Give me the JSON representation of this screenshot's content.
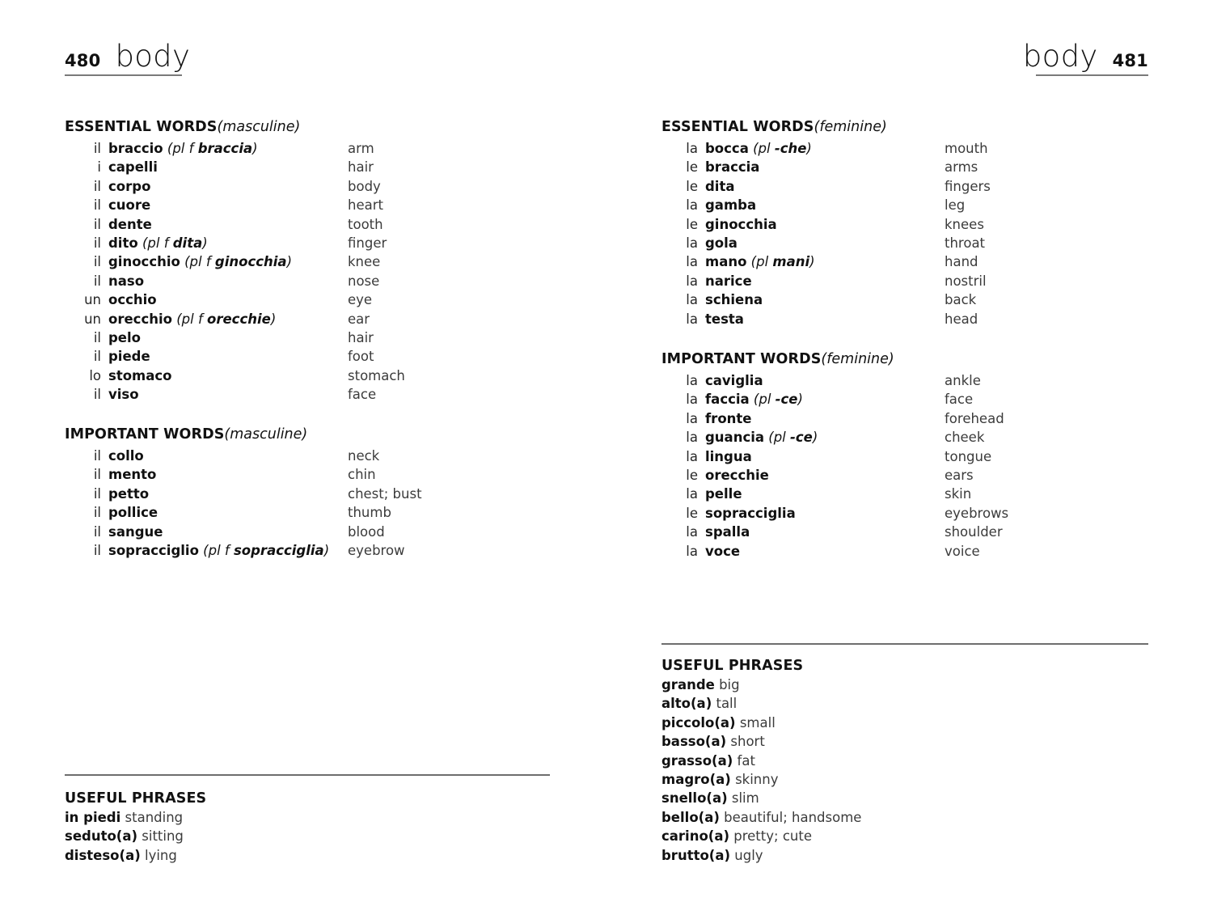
{
  "spread": {
    "left_page": {
      "folio": "480",
      "running_head": "body",
      "sections": [
        {
          "title": "ESSENTIAL WORDS",
          "gender": "(masculine)",
          "entries": [
            {
              "article": "il",
              "term": "braccio",
              "plural_open": " (",
              "plural_label": "pl f ",
              "plural_form": "braccia",
              "plural_close": ")",
              "gloss": "arm"
            },
            {
              "article": "i",
              "term": "capelli",
              "plural_open": "",
              "plural_label": "",
              "plural_form": "",
              "plural_close": "",
              "gloss": "hair"
            },
            {
              "article": "il",
              "term": "corpo",
              "plural_open": "",
              "plural_label": "",
              "plural_form": "",
              "plural_close": "",
              "gloss": "body"
            },
            {
              "article": "il",
              "term": "cuore",
              "plural_open": "",
              "plural_label": "",
              "plural_form": "",
              "plural_close": "",
              "gloss": "heart"
            },
            {
              "article": "il",
              "term": "dente",
              "plural_open": "",
              "plural_label": "",
              "plural_form": "",
              "plural_close": "",
              "gloss": "tooth"
            },
            {
              "article": "il",
              "term": "dito",
              "plural_open": " (",
              "plural_label": "pl f ",
              "plural_form": "dita",
              "plural_close": ")",
              "gloss": "finger"
            },
            {
              "article": "il",
              "term": "ginocchio",
              "plural_open": " (",
              "plural_label": "pl f ",
              "plural_form": "ginocchia",
              "plural_close": ")",
              "gloss": "knee"
            },
            {
              "article": "il",
              "term": "naso",
              "plural_open": "",
              "plural_label": "",
              "plural_form": "",
              "plural_close": "",
              "gloss": "nose"
            },
            {
              "article": "un",
              "term": "occhio",
              "plural_open": "",
              "plural_label": "",
              "plural_form": "",
              "plural_close": "",
              "gloss": "eye"
            },
            {
              "article": "un",
              "term": "orecchio",
              "plural_open": " (",
              "plural_label": "pl f ",
              "plural_form": "orecchie",
              "plural_close": ")",
              "gloss": "ear"
            },
            {
              "article": "il",
              "term": "pelo",
              "plural_open": "",
              "plural_label": "",
              "plural_form": "",
              "plural_close": "",
              "gloss": "hair"
            },
            {
              "article": "il",
              "term": "piede",
              "plural_open": "",
              "plural_label": "",
              "plural_form": "",
              "plural_close": "",
              "gloss": "foot"
            },
            {
              "article": "lo",
              "term": "stomaco",
              "plural_open": "",
              "plural_label": "",
              "plural_form": "",
              "plural_close": "",
              "gloss": "stomach"
            },
            {
              "article": "il",
              "term": "viso",
              "plural_open": "",
              "plural_label": "",
              "plural_form": "",
              "plural_close": "",
              "gloss": "face"
            }
          ]
        },
        {
          "title": "IMPORTANT WORDS",
          "gender": "(masculine)",
          "entries": [
            {
              "article": "il",
              "term": "collo",
              "plural_open": "",
              "plural_label": "",
              "plural_form": "",
              "plural_close": "",
              "gloss": "neck"
            },
            {
              "article": "il",
              "term": "mento",
              "plural_open": "",
              "plural_label": "",
              "plural_form": "",
              "plural_close": "",
              "gloss": "chin"
            },
            {
              "article": "il",
              "term": "petto",
              "plural_open": "",
              "plural_label": "",
              "plural_form": "",
              "plural_close": "",
              "gloss": "chest; bust"
            },
            {
              "article": "il",
              "term": "pollice",
              "plural_open": "",
              "plural_label": "",
              "plural_form": "",
              "plural_close": "",
              "gloss": "thumb"
            },
            {
              "article": "il",
              "term": "sangue",
              "plural_open": "",
              "plural_label": "",
              "plural_form": "",
              "plural_close": "",
              "gloss": "blood"
            },
            {
              "article": "il",
              "term": "sopracciglio",
              "plural_open": " (",
              "plural_label": "pl f ",
              "plural_form": "sopracciglia",
              "plural_close": ")",
              "gloss": "eyebrow"
            }
          ]
        }
      ],
      "useful_phrases": {
        "title": "USEFUL PHRASES",
        "items": [
          {
            "italian": "in piedi",
            "english": " standing"
          },
          {
            "italian": "seduto(a)",
            "english": " sitting"
          },
          {
            "italian": "disteso(a)",
            "english": " lying"
          }
        ]
      }
    },
    "right_page": {
      "folio": "481",
      "running_head": "body",
      "sections": [
        {
          "title": "ESSENTIAL WORDS",
          "gender": "(feminine)",
          "entries": [
            {
              "article": "la",
              "term": "bocca",
              "plural_open": " (",
              "plural_label": "pl ",
              "plural_form": "-che",
              "plural_close": ")",
              "gloss": "mouth"
            },
            {
              "article": "le",
              "term": "braccia",
              "plural_open": "",
              "plural_label": "",
              "plural_form": "",
              "plural_close": "",
              "gloss": "arms"
            },
            {
              "article": "le",
              "term": "dita",
              "plural_open": "",
              "plural_label": "",
              "plural_form": "",
              "plural_close": "",
              "gloss": "fingers"
            },
            {
              "article": "la",
              "term": "gamba",
              "plural_open": "",
              "plural_label": "",
              "plural_form": "",
              "plural_close": "",
              "gloss": "leg"
            },
            {
              "article": "le",
              "term": "ginocchia",
              "plural_open": "",
              "plural_label": "",
              "plural_form": "",
              "plural_close": "",
              "gloss": "knees"
            },
            {
              "article": "la",
              "term": "gola",
              "plural_open": "",
              "plural_label": "",
              "plural_form": "",
              "plural_close": "",
              "gloss": "throat"
            },
            {
              "article": "la",
              "term": "mano",
              "plural_open": " (",
              "plural_label": "pl ",
              "plural_form": "mani",
              "plural_close": ")",
              "gloss": "hand"
            },
            {
              "article": "la",
              "term": "narice",
              "plural_open": "",
              "plural_label": "",
              "plural_form": "",
              "plural_close": "",
              "gloss": "nostril"
            },
            {
              "article": "la",
              "term": "schiena",
              "plural_open": "",
              "plural_label": "",
              "plural_form": "",
              "plural_close": "",
              "gloss": "back"
            },
            {
              "article": "la",
              "term": "testa",
              "plural_open": "",
              "plural_label": "",
              "plural_form": "",
              "plural_close": "",
              "gloss": "head"
            }
          ]
        },
        {
          "title": "IMPORTANT WORDS",
          "gender": "(feminine)",
          "entries": [
            {
              "article": "la",
              "term": "caviglia",
              "plural_open": "",
              "plural_label": "",
              "plural_form": "",
              "plural_close": "",
              "gloss": "ankle"
            },
            {
              "article": "la",
              "term": "faccia",
              "plural_open": " (",
              "plural_label": "pl ",
              "plural_form": "-ce",
              "plural_close": ")",
              "gloss": "face"
            },
            {
              "article": "la",
              "term": "fronte",
              "plural_open": "",
              "plural_label": "",
              "plural_form": "",
              "plural_close": "",
              "gloss": "forehead"
            },
            {
              "article": "la",
              "term": "guancia",
              "plural_open": " (",
              "plural_label": "pl ",
              "plural_form": "-ce",
              "plural_close": ")",
              "gloss": "cheek"
            },
            {
              "article": "la",
              "term": "lingua",
              "plural_open": "",
              "plural_label": "",
              "plural_form": "",
              "plural_close": "",
              "gloss": "tongue"
            },
            {
              "article": "le",
              "term": "orecchie",
              "plural_open": "",
              "plural_label": "",
              "plural_form": "",
              "plural_close": "",
              "gloss": "ears"
            },
            {
              "article": "la",
              "term": "pelle",
              "plural_open": "",
              "plural_label": "",
              "plural_form": "",
              "plural_close": "",
              "gloss": "skin"
            },
            {
              "article": "le",
              "term": "sopracciglia",
              "plural_open": "",
              "plural_label": "",
              "plural_form": "",
              "plural_close": "",
              "gloss": "eyebrows"
            },
            {
              "article": "la",
              "term": "spalla",
              "plural_open": "",
              "plural_label": "",
              "plural_form": "",
              "plural_close": "",
              "gloss": "shoulder"
            },
            {
              "article": "la",
              "term": "voce",
              "plural_open": "",
              "plural_label": "",
              "plural_form": "",
              "plural_close": "",
              "gloss": "voice"
            }
          ]
        }
      ],
      "useful_phrases": {
        "title": "USEFUL PHRASES",
        "items": [
          {
            "italian": "grande",
            "english": " big"
          },
          {
            "italian": "alto(a)",
            "english": " tall"
          },
          {
            "italian": "piccolo(a)",
            "english": " small"
          },
          {
            "italian": "basso(a)",
            "english": " short"
          },
          {
            "italian": "grasso(a)",
            "english": " fat"
          },
          {
            "italian": "magro(a)",
            "english": " skinny"
          },
          {
            "italian": "snello(a)",
            "english": " slim"
          },
          {
            "italian": "bello(a)",
            "english": " beautiful; handsome"
          },
          {
            "italian": "carino(a)",
            "english": " pretty; cute"
          },
          {
            "italian": "brutto(a)",
            "english": " ugly"
          }
        ]
      }
    }
  }
}
